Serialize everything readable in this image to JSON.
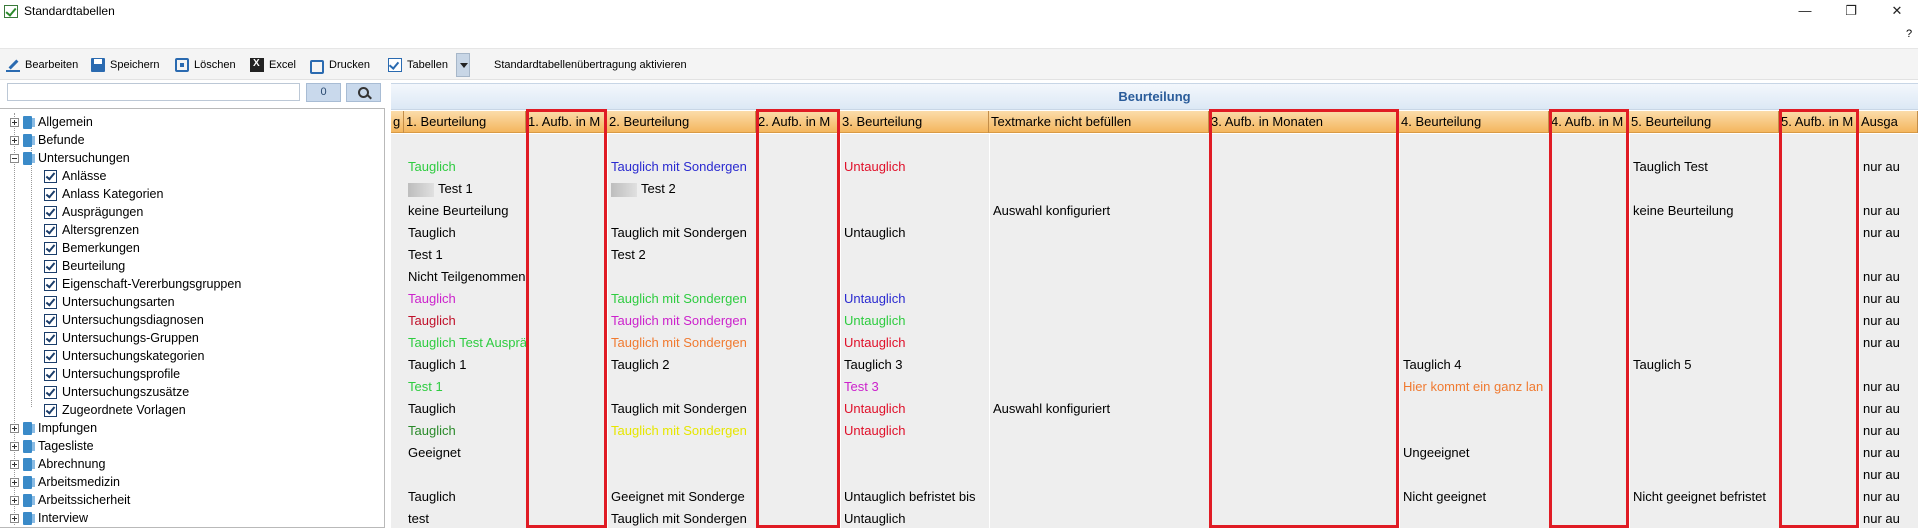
{
  "window": {
    "title": "Standardtabellen",
    "minimize": "—",
    "maximize": "❐",
    "close": "✕",
    "help": "?"
  },
  "toolbar": {
    "edit": "Bearbeiten",
    "save": "Speichern",
    "delete": "Löschen",
    "excel": "Excel",
    "print": "Drucken",
    "tables": "Tabellen",
    "activate_transfer": "Standardtabellenübertragung aktivieren"
  },
  "left_panel": {
    "search_value": "",
    "count": "0"
  },
  "tree": {
    "allgemein": "Allgemein",
    "befunde": "Befunde",
    "untersuchungen": "Untersuchungen",
    "children": [
      "Anlässe",
      "Anlass Kategorien",
      "Ausprägungen",
      "Altersgrenzen",
      "Bemerkungen",
      "Beurteilung",
      "Eigenschaft-Vererbungsgruppen",
      "Untersuchungsarten",
      "Untersuchungsdiagnosen",
      "Untersuchungs-Gruppen",
      "Untersuchungskategorien",
      "Untersuchungsprofile",
      "Untersuchungszusätze",
      "Zugeordnete Vorlagen"
    ],
    "after": [
      "Impfungen",
      "Tagesliste",
      "Abrechnung",
      "Arbeitsmedizin",
      "Arbeitssicherheit",
      "Interview"
    ]
  },
  "grid": {
    "title": "Beurteilung",
    "headers": [
      "g",
      "1. Beurteilung",
      "1. Aufb. in M",
      "2. Beurteilung",
      "2. Aufb. in M",
      "3. Beurteilung",
      "Textmarke nicht befüllen",
      "3. Aufb. in Monaten",
      "4. Beurteilung",
      "4. Aufb. in M",
      "5. Beurteilung",
      "5. Aufb. in M",
      "Ausga"
    ],
    "rows": [
      {
        "b1": "",
        "b2": "",
        "b3": "",
        "tm": "",
        "b4": "",
        "b5": "",
        "aus": ""
      },
      {
        "b1": "Tauglich",
        "b2": "Tauglich mit Sondergen",
        "b3": "Untauglich",
        "tm": "",
        "b4": "",
        "b5": "Tauglich Test",
        "aus": "nur au"
      },
      {
        "b1": "Test 1",
        "b2": "Test 2",
        "b3": "",
        "tm": "",
        "b4": "",
        "b5": "",
        "aus": ""
      },
      {
        "b1": "keine Beurteilung",
        "b2": "",
        "b3": "",
        "tm": "Auswahl konfiguriert",
        "b4": "",
        "b5": "keine Beurteilung",
        "aus": "nur au"
      },
      {
        "b1": "Tauglich",
        "b2": "Tauglich mit Sondergen",
        "b3": "Untauglich",
        "tm": "",
        "b4": "",
        "b5": "",
        "aus": "nur au"
      },
      {
        "b1": "Test 1",
        "b2": "Test 2",
        "b3": "",
        "tm": "",
        "b4": "",
        "b5": "",
        "aus": ""
      },
      {
        "b1": "Nicht Teilgenommen",
        "b2": "",
        "b3": "",
        "tm": "",
        "b4": "",
        "b5": "",
        "aus": "nur au"
      },
      {
        "b1": "Tauglich",
        "b2": "Tauglich mit Sondergen",
        "b3": "Untauglich",
        "tm": "",
        "b4": "",
        "b5": "",
        "aus": "nur au"
      },
      {
        "b1": "Tauglich",
        "b2": "Tauglich mit Sondergen",
        "b3": "Untauglich",
        "tm": "",
        "b4": "",
        "b5": "",
        "aus": "nur au"
      },
      {
        "b1": "Tauglich Test Ausprägu",
        "b2": "Tauglich mit Sondergen",
        "b3": "Untauglich",
        "tm": "",
        "b4": "",
        "b5": "",
        "aus": "nur au"
      },
      {
        "b1": "Tauglich 1",
        "b2": "Tauglich 2",
        "b3": "Tauglich 3",
        "tm": "",
        "b4": "Tauglich 4",
        "b5": "Tauglich 5",
        "aus": ""
      },
      {
        "b1": "Test 1",
        "b2": "",
        "b3": "Test 3",
        "tm": "",
        "b4": "Hier kommt ein ganz lan",
        "b5": "",
        "aus": "nur au"
      },
      {
        "b1": "Tauglich",
        "b2": "Tauglich mit Sondergen",
        "b3": "Untauglich",
        "tm": "Auswahl konfiguriert",
        "b4": "",
        "b5": "",
        "aus": "nur au"
      },
      {
        "b1": "Tauglich",
        "b2": "Tauglich mit Sondergen",
        "b3": "Untauglich",
        "tm": "",
        "b4": "",
        "b5": "",
        "aus": "nur au"
      },
      {
        "b1": "Geeignet",
        "b2": "",
        "b3": "",
        "tm": "",
        "b4": "Ungeeignet",
        "b5": "",
        "aus": "nur au"
      },
      {
        "b1": "",
        "b2": "",
        "b3": "",
        "tm": "",
        "b4": "",
        "b5": "",
        "aus": "nur au"
      },
      {
        "b1": "Tauglich",
        "b2": "Geeignet mit Sonderge",
        "b3": "Untauglich befristet bis",
        "tm": "",
        "b4": "Nicht geeignet",
        "b5": "Nicht geeignet befristet",
        "aus": "nur au"
      },
      {
        "b1": "test",
        "b2": "Tauglich mit Sondergen",
        "b3": "Untauglich",
        "tm": "",
        "b4": "",
        "b5": "",
        "aus": "nur au"
      }
    ]
  },
  "colors": {
    "green": "#2ecc40",
    "blue": "#2a2ad0",
    "red": "#e0102a",
    "magenta": "#cc22cc",
    "orange": "#f07a30",
    "yellow": "#e6e600",
    "highlight": "#e01b24",
    "header_orange": "#f4b65e",
    "title_blue": "#2a5c9a"
  }
}
